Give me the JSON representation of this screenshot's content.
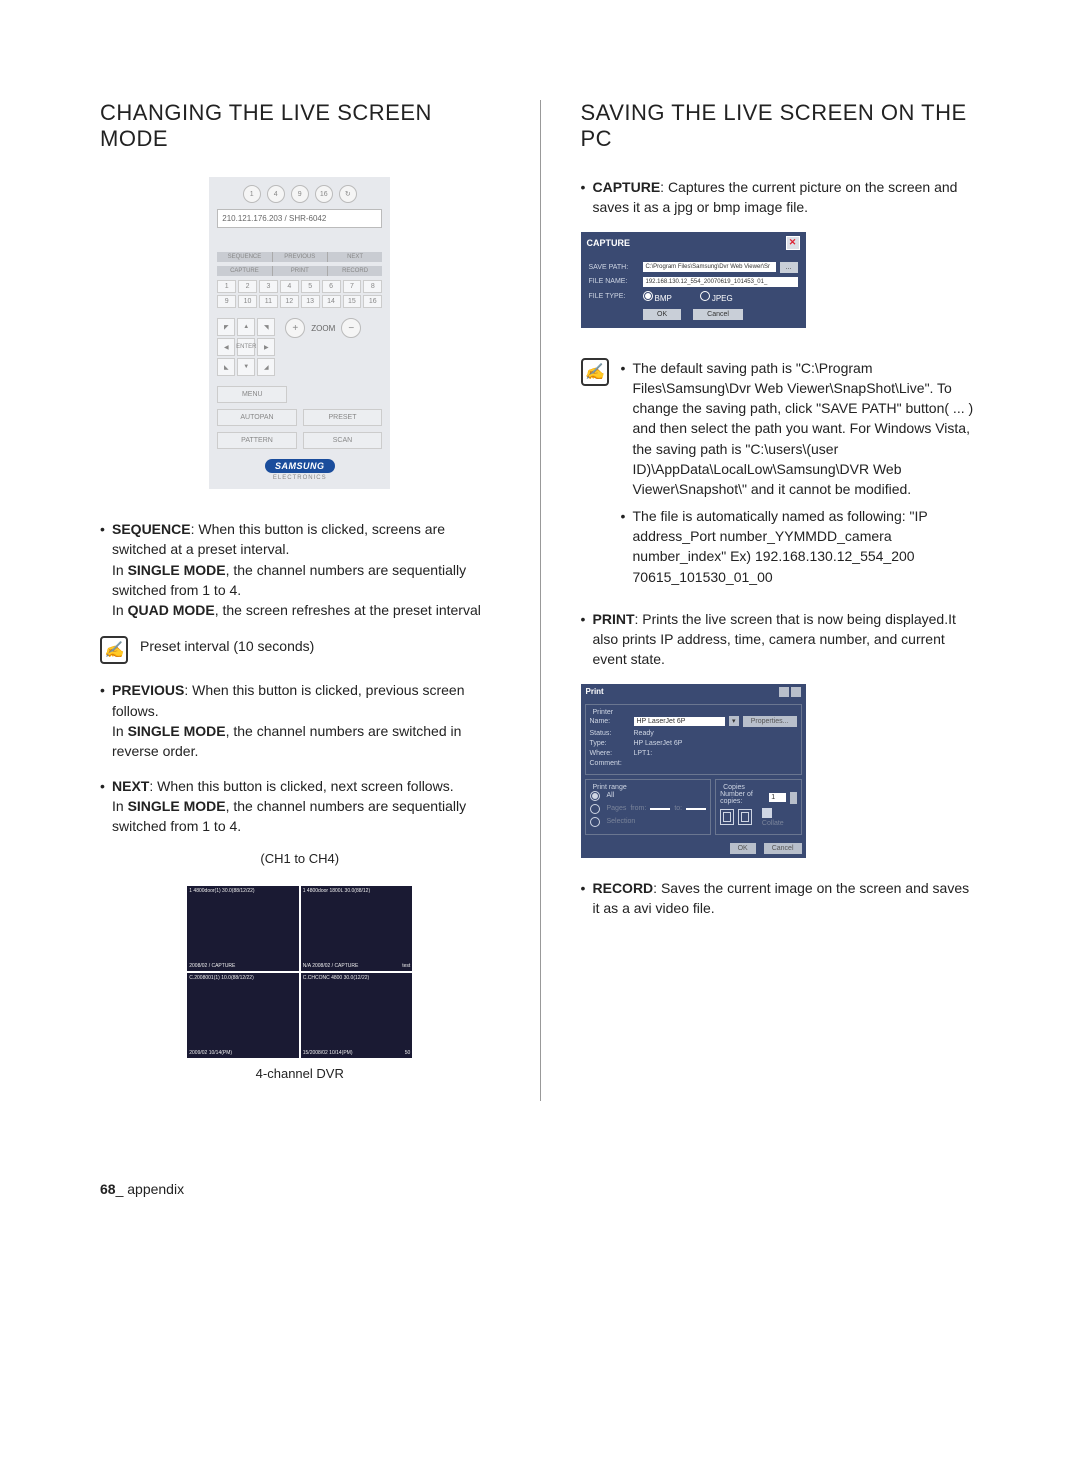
{
  "left": {
    "heading": "CHANGING THE LIVE SCREEN MODE",
    "panel": {
      "circles": [
        "1",
        "4",
        "9",
        "16"
      ],
      "cycle_icon": "cycle-icon",
      "address": "210.121.176.203 / SHR-6042",
      "tabs_top": [
        "SEQUENCE",
        "PREVIOUS",
        "NEXT"
      ],
      "tabs_mid": [
        "CAPTURE",
        "PRINT",
        "RECORD"
      ],
      "grid": [
        "1",
        "2",
        "3",
        "4",
        "5",
        "6",
        "7",
        "8",
        "9",
        "10",
        "11",
        "12",
        "13",
        "14",
        "15",
        "16"
      ],
      "ptz": {
        "up": "▲",
        "down": "▼",
        "left": "◀",
        "right": "▶",
        "enter": "ENTER",
        "tl": "◤",
        "tr": "◥",
        "bl": "◣",
        "br": "◢"
      },
      "zoom": {
        "plus": "+",
        "label": "ZOOM",
        "minus": "−"
      },
      "menu": "MENU",
      "autopan": "AUTOPAN",
      "preset": "PRESET",
      "pattern": "PATTERN",
      "scan": "SCAN",
      "logo": "SAMSUNG",
      "logo_sub": "ELECTRONICS"
    },
    "b_sequence": {
      "title": "SEQUENCE",
      "text1": ": When this button is clicked, screens are switched at a preset interval.",
      "text2a": "In ",
      "single": "SINGLE MODE",
      "text2b": ", the channel numbers are sequentially switched from 1 to 4.",
      "text3a": "In ",
      "quad": "QUAD MODE",
      "text3b": ", the screen refreshes at the preset interval"
    },
    "note_preset": "Preset interval (10 seconds)",
    "b_previous": {
      "title": "PREVIOUS",
      "text1": ": When this button is clicked, previous screen follows.",
      "text2a": "In ",
      "single": "SINGLE MODE",
      "text2b": ", the channel numbers are switched in reverse order."
    },
    "b_next": {
      "title": "NEXT",
      "text1": ": When this button is clicked, next screen follows.",
      "text2a": "In ",
      "single": "SINGLE MODE",
      "text2b": ", the channel numbers are sequentially switched from 1 to 4."
    },
    "caption_top": "(CH1 to CH4)",
    "quad": {
      "cells": [
        {
          "top": "1 4800door(1) 30.0(88/12/22)",
          "b1": "2008/02 / CAPTURE",
          "b2": ""
        },
        {
          "top": "1 4800door 1800L 30.0(88/12)",
          "b1": "N/A 2008/02 / CAPTURE",
          "b2": "test"
        },
        {
          "top": "C.2008001(1) 10.0(88/12/22)",
          "b1": "2009/02 10/14(PM)",
          "b2": ""
        },
        {
          "top": "C.CHCONC 4800 30.0(12/22)",
          "b1": "15/2008/02 10/14(PM)",
          "b2": "50"
        }
      ]
    },
    "caption_bottom": "4-channel DVR"
  },
  "right": {
    "heading": "SAVING THE LIVE SCREEN ON THE PC",
    "b_capture": {
      "title": "CAPTURE",
      "text": ": Captures the current picture on the screen and saves it as a jpg or bmp image file."
    },
    "capture_dlg": {
      "title": "CAPTURE",
      "save_path_lbl": "SAVE PATH:",
      "save_path": "C:\\Program Files\\Samsung\\Dvr Web Viewer\\Sr",
      "browse": "...",
      "file_name_lbl": "FILE NAME:",
      "file_name": "192.168.130.12_554_20070619_101453_01_",
      "file_type_lbl": "FILE TYPE:",
      "bmp": "BMP",
      "jpeg": "JPEG",
      "ok": "OK",
      "cancel": "Cancel"
    },
    "note_paths": [
      "The default saving path is \"C:\\Program Files\\Samsung\\Dvr Web Viewer\\SnapShot\\Live\". To change the saving path, click \"SAVE PATH\" button( ... ) and then select the path you want. For Windows Vista, the saving path is \"C:\\users\\(user ID)\\AppData\\LocalLow\\Samsung\\DVR Web Viewer\\Snapshot\\\" and it cannot be modified.",
      "The file is automatically named as following: \"IP address_Port number_YYMMDD_camera number_index\" Ex) 192.168.130.12_554_200 70615_101530_01_00"
    ],
    "b_print": {
      "title": "PRINT",
      "text": ": Prints the live screen that is now being displayed.It also prints IP address, time, camera number, and current event state."
    },
    "print_dlg": {
      "title": "Print",
      "legend_printer": "Printer",
      "name_lbl": "Name:",
      "name_val": "HP LaserJet 6P",
      "properties": "Properties...",
      "status_lbl": "Status:",
      "status_val": "Ready",
      "type_lbl": "Type:",
      "type_val": "HP LaserJet 6P",
      "where_lbl": "Where:",
      "where_val": "LPT1:",
      "comment_lbl": "Comment:",
      "legend_range": "Print range",
      "all": "All",
      "pages": "Pages",
      "from": "from:",
      "to": "to:",
      "selection": "Selection",
      "legend_copies": "Copies",
      "ncopies_lbl": "Number of copies:",
      "ncopies_val": "1",
      "collate": "Collate",
      "ok": "OK",
      "cancel": "Cancel"
    },
    "b_record": {
      "title": "RECORD",
      "text": ": Saves the current image on the screen and saves it as a avi video file."
    }
  },
  "footer": {
    "page": "68",
    "section": "_ appendix"
  }
}
